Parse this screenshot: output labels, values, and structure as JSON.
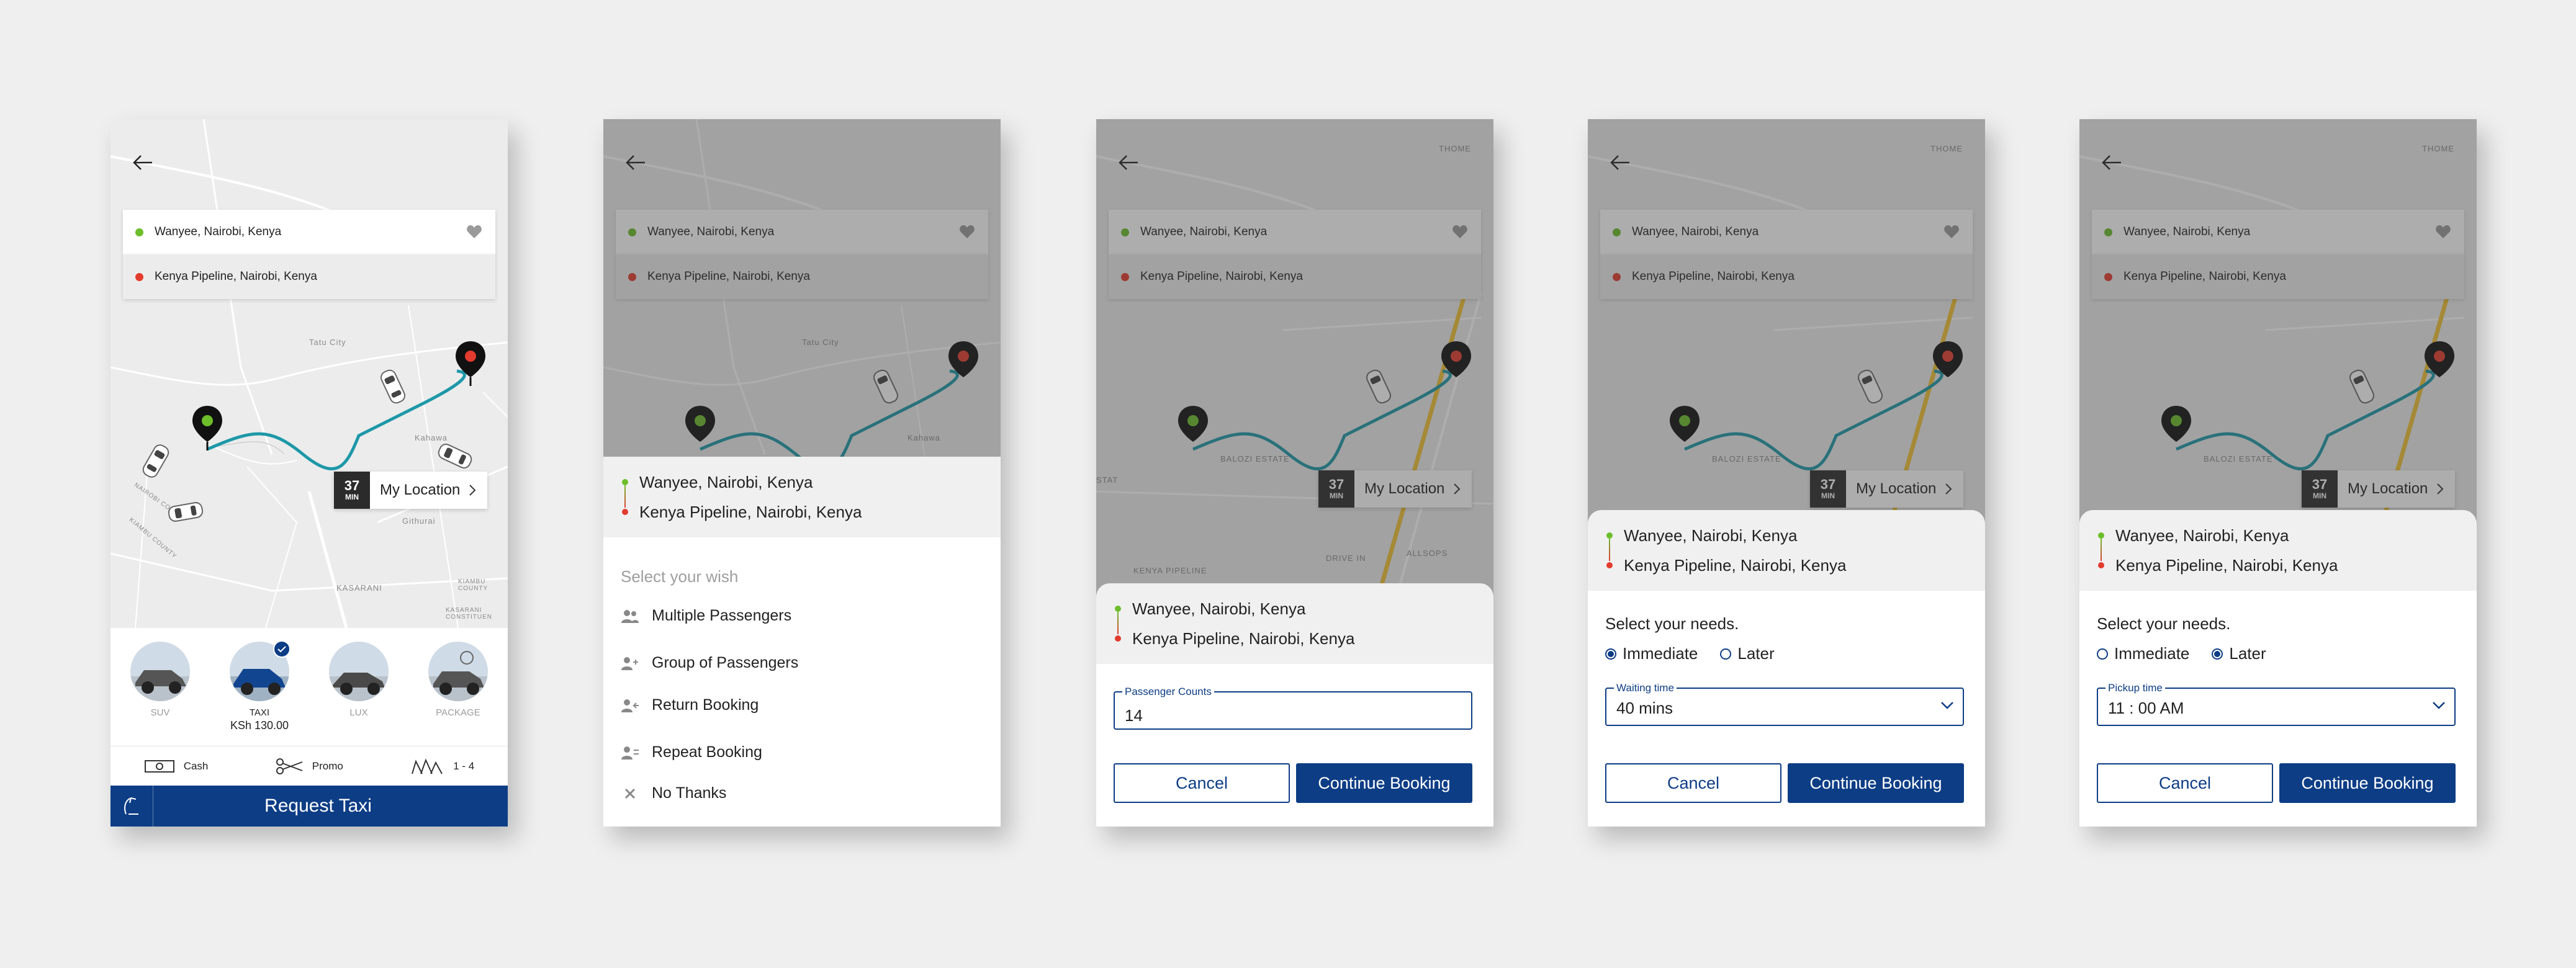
{
  "common": {
    "pickup": "Wanyee, Nairobi, Kenya",
    "dropoff": "Kenya Pipeline, Nairobi, Kenya",
    "eta_value": "37",
    "eta_unit": "MIN",
    "my_location": "My Location",
    "cancel": "Cancel",
    "continue": "Continue Booking"
  },
  "map_labels": {
    "tatu_city": "Tatu City",
    "kahawa": "Kahawa",
    "kasarani": "KASARANI",
    "githurai": "Githurai",
    "kasarani_const": "KASARANI CONSTITUEN",
    "kiambu_county": "KIAMBU COUNTY",
    "kiambu_county2": "KIAMBU COUNTY",
    "nairobi_county": "NAIROBI COUNTY",
    "thome": "THOME",
    "balozi_estate": "BALOZI ESTATE",
    "kenya_pipeline": "KENYA PIPELINE",
    "drive_in": "DRIVE IN",
    "allsops": "ALLSOPS",
    "stat": "STAT"
  },
  "screen1": {
    "categories": [
      {
        "name": "SUV",
        "icon": "suv-car-icon"
      },
      {
        "name": "TAXI",
        "price": "KSh 130.00",
        "icon": "taxi-car-icon"
      },
      {
        "name": "LUX",
        "icon": "lux-car-icon"
      },
      {
        "name": "PACKAGE",
        "icon": "package-car-icon"
      }
    ],
    "options": {
      "payment": "Cash",
      "promo": "Promo",
      "seats": "1 - 4"
    },
    "request": "Request Taxi"
  },
  "screen2": {
    "title": "Select your wish",
    "items": [
      "Multiple Passengers",
      "Group of Passengers",
      "Return Booking",
      "Repeat Booking",
      "No Thanks"
    ]
  },
  "screen3": {
    "field_label": "Passenger Counts",
    "field_value": "14"
  },
  "screen4": {
    "title": "Select your needs.",
    "immediate": "Immediate",
    "later": "Later",
    "selected": "Immediate",
    "field_label": "Waiting time",
    "field_value": "40 mins"
  },
  "screen5": {
    "title": "Select your needs.",
    "immediate": "Immediate",
    "later": "Later",
    "selected": "Later",
    "field_label": "Pickup time",
    "field_value": "11 : 00 AM"
  },
  "colors": {
    "primary": "#0d3d85",
    "route": "#1d98a8",
    "pickup": "#6cbe2a",
    "dropoff": "#e33b2e"
  }
}
